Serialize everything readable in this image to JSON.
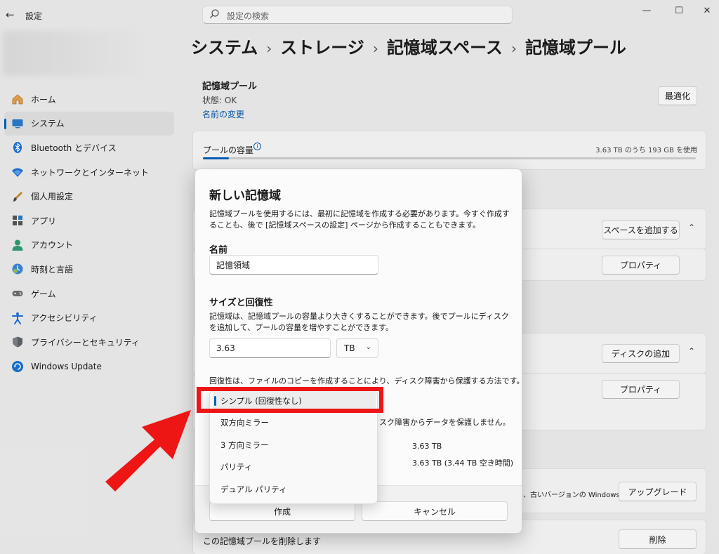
{
  "window": {
    "app_title": "設定",
    "back_glyph": "←",
    "minimize_glyph": "—",
    "maximize_glyph": "☐",
    "close_glyph": "✕"
  },
  "search": {
    "placeholder": "設定の検索"
  },
  "sidebar": {
    "items": [
      {
        "label": "ホーム",
        "icon": "home-icon"
      },
      {
        "label": "システム",
        "icon": "system-icon",
        "selected": true
      },
      {
        "label": "Bluetooth とデバイス",
        "icon": "bluetooth-icon"
      },
      {
        "label": "ネットワークとインターネット",
        "icon": "network-icon"
      },
      {
        "label": "個人用設定",
        "icon": "personalization-icon"
      },
      {
        "label": "アプリ",
        "icon": "apps-icon"
      },
      {
        "label": "アカウント",
        "icon": "account-icon"
      },
      {
        "label": "時刻と言語",
        "icon": "time-language-icon"
      },
      {
        "label": "ゲーム",
        "icon": "gaming-icon"
      },
      {
        "label": "アクセシビリティ",
        "icon": "accessibility-icon"
      },
      {
        "label": "プライバシーとセキュリティ",
        "icon": "privacy-icon"
      },
      {
        "label": "Windows Update",
        "icon": "windows-update-icon"
      }
    ]
  },
  "breadcrumb": {
    "items": [
      "システム",
      "ストレージ",
      "記憶域スペース",
      "記憶域プール"
    ],
    "separator": "›"
  },
  "pool": {
    "title": "記憶域プール",
    "status": "状態: OK",
    "rename_link": "名前の変更",
    "optimize_button": "最適化",
    "capacity_label": "プールの容量",
    "capacity_usage": "3.63 TB のうち 193 GB を使用",
    "capacity_used_fraction": 0.052,
    "add_space_button": "スペースを追加する",
    "properties_button": "プロパティ",
    "add_disk_button": "ディスクの追加",
    "properties_button_2": "プロパティ",
    "upgrade_text": "、古いバージョンの Windows",
    "upgrade_button": "アップグレード",
    "delete_text": "この記憶域プールを削除します",
    "delete_button": "削除"
  },
  "dialog": {
    "title": "新しい記憶域",
    "description": "記憶域プールを使用するには、最初に記憶域を作成する必要があります。今すぐ作成することも、後で [記憶域スペースの設定] ページから作成することもできます。",
    "name_label": "名前",
    "name_value": "記憶領域",
    "size_label": "サイズと回復性",
    "size_description": "記憶域は、記憶域プールの容量より大きくすることができます。後でプールにディスクを追加して、プールの容量を増やすことができます。",
    "size_value": "3.63",
    "size_unit": "TB",
    "resiliency_description": "回復性は、ファイルのコピーを作成することにより、ディスク障害から保護する方法です。",
    "resiliency_note": "スク障害からデータを保護しません。",
    "size_summary_1": "3.63 TB",
    "size_summary_2": "3.63 TB (3.44 TB 空き時間)",
    "create_button": "作成",
    "cancel_button": "キャンセル"
  },
  "resiliency_options": {
    "selected": "シンプル (回復性なし)",
    "items": [
      "シンプル (回復性なし)",
      "双方向ミラー",
      "3 方向ミラー",
      "パリティ",
      "デュアル パリティ"
    ]
  },
  "colors": {
    "accent": "#005fb8",
    "annotation_red": "#ee1515",
    "link": "#0a5cad"
  }
}
